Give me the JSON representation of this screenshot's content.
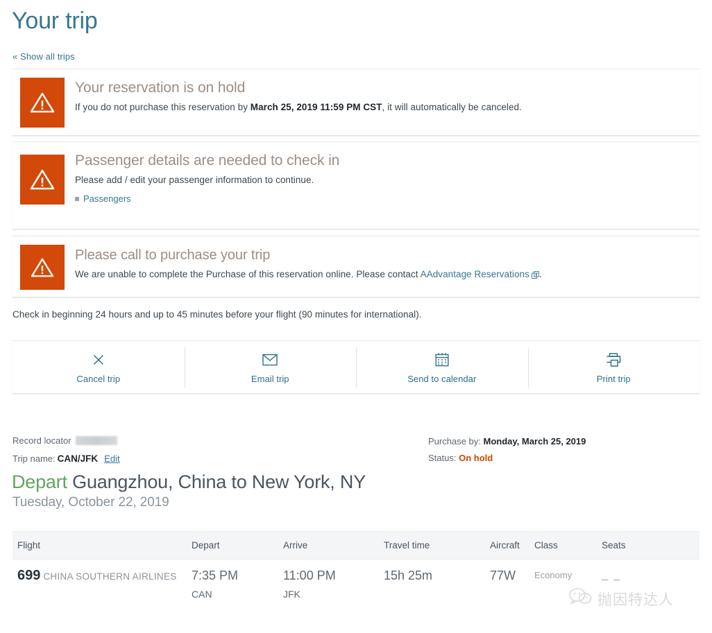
{
  "header": {
    "title": "Your trip",
    "show_all_trips": "« Show all trips"
  },
  "alerts": [
    {
      "id": "reservation-on-hold",
      "icon": "warning-triangle-icon",
      "heading": "Your reservation is on hold",
      "body_prefix": "If you do not purchase this reservation by ",
      "body_bold": "March 25, 2019 11:59 PM CST",
      "body_suffix": ", it will automatically be canceled."
    },
    {
      "id": "passenger-details-needed",
      "icon": "warning-triangle-icon",
      "heading": "Passenger details are needed to check in",
      "body": "Please add / edit your passenger information to continue.",
      "link": "Passengers"
    },
    {
      "id": "please-call-to-purchase",
      "icon": "warning-triangle-icon",
      "heading": "Please call to purchase your trip",
      "body_prefix": "We are unable to complete the Purchase of this reservation online. Please contact ",
      "link": "AAdvantage Reservations",
      "body_suffix": "."
    }
  ],
  "checkin_note": "Check in beginning 24 hours and up to 45 minutes before your flight (90 minutes for international).",
  "actions": [
    {
      "label": "Cancel trip",
      "icon": "close-x-icon"
    },
    {
      "label": "Email trip",
      "icon": "envelope-icon"
    },
    {
      "label": "Send to calendar",
      "icon": "calendar-icon"
    },
    {
      "label": "Print trip",
      "icon": "printer-icon"
    }
  ],
  "reservation": {
    "record_locator_label": "Record locator",
    "record_locator_value": "",
    "trip_name_label": "Trip name:",
    "trip_name_value": "CAN/JFK",
    "edit_label": "Edit",
    "purchase_by_label": "Purchase by:",
    "purchase_by_value": "Monday, March 25, 2019",
    "status_label": "Status:",
    "status_value": "On hold"
  },
  "segment": {
    "depart_word": "Depart",
    "route": " Guangzhou, China to New York, NY",
    "date": "Tuesday, October 22, 2019"
  },
  "flight_table": {
    "columns": [
      "Flight",
      "Depart",
      "Arrive",
      "Travel time",
      "Aircraft",
      "Class",
      "Seats"
    ],
    "rows": [
      {
        "flight_number": "699",
        "carrier": "CHINA SOUTHERN AIRLINES",
        "depart_time": "7:35 PM",
        "depart_code": "CAN",
        "arrive_time": "11:00 PM",
        "arrive_code": "JFK",
        "travel_time": "15h 25m",
        "aircraft": "77W",
        "class": "Economy",
        "seats": "_ _"
      }
    ]
  },
  "watermark": {
    "icon": "wechat-icon",
    "text": "抛因特达人"
  },
  "colors": {
    "accent_teal": "#36778f",
    "alert_orange": "#d2490a",
    "status_orange": "#cf4500",
    "depart_green": "#62a45f",
    "alert_heading": "#9b8e84"
  }
}
